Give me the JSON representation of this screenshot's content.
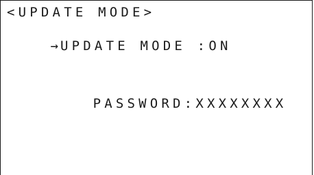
{
  "screen": {
    "title": "<UPDATE MODE>",
    "cursor": "→",
    "setting_label": "UPDATE MODE",
    "setting_separator": " :",
    "setting_value": "ON",
    "password_label": "PASSWORD:",
    "password_value": "XXXXXXXX"
  }
}
